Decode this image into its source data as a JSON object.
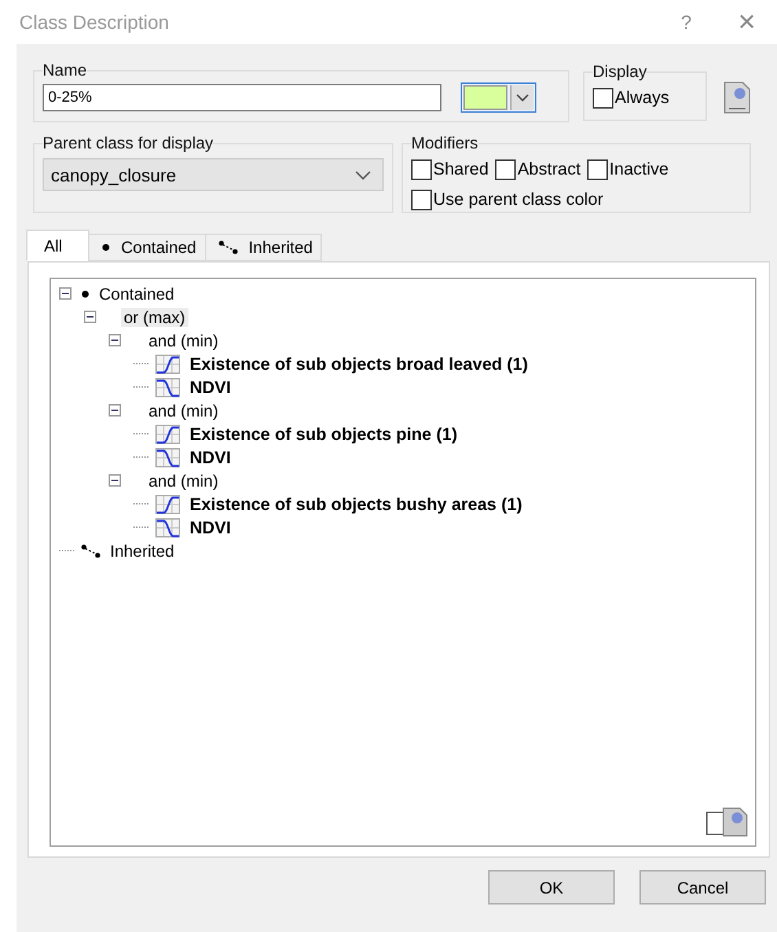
{
  "window": {
    "title": "Class Description",
    "help": "?",
    "close": "×"
  },
  "name_group": {
    "label": "Name",
    "value": "0-25%"
  },
  "display_group": {
    "label": "Display",
    "checkboxes": [
      {
        "label": "Always",
        "checked": false
      }
    ]
  },
  "parent_group": {
    "label": "Parent class for display",
    "value": "canopy_closure"
  },
  "modifiers_group": {
    "label": "Modifiers",
    "checkboxes": [
      {
        "label": "Shared",
        "checked": false
      },
      {
        "label": "Abstract",
        "checked": false
      },
      {
        "label": "Inactive",
        "checked": false
      },
      {
        "label": "Use parent class color",
        "checked": false
      }
    ]
  },
  "tabs": [
    {
      "label": "All",
      "kind": "plain",
      "selected": true
    },
    {
      "label": "Contained",
      "kind": "dot",
      "selected": false
    },
    {
      "label": "Inherited",
      "kind": "link",
      "selected": false
    }
  ],
  "tree": [
    {
      "label": "Contained",
      "kind": "dot",
      "expanded": true,
      "selected": false,
      "children": [
        {
          "label": "or (max)",
          "kind": "operator",
          "expanded": true,
          "selected": true,
          "children": [
            {
              "label": "and (min)",
              "kind": "operator",
              "expanded": true,
              "selected": false,
              "children": [
                {
                  "label": "Existence of sub objects broad leaved (1)",
                  "kind": "rising",
                  "selected": false
                },
                {
                  "label": "NDVI",
                  "kind": "falling",
                  "selected": false
                }
              ]
            },
            {
              "label": "and (min)",
              "kind": "operator",
              "expanded": true,
              "selected": false,
              "children": [
                {
                  "label": "Existence of sub objects pine (1)",
                  "kind": "rising",
                  "selected": false
                },
                {
                  "label": "NDVI",
                  "kind": "falling",
                  "selected": false
                }
              ]
            },
            {
              "label": "and (min)",
              "kind": "operator",
              "expanded": true,
              "selected": false,
              "children": [
                {
                  "label": "Existence of sub objects bushy areas (1)",
                  "kind": "rising",
                  "selected": false
                },
                {
                  "label": "NDVI",
                  "kind": "falling",
                  "selected": false
                }
              ]
            }
          ]
        }
      ]
    },
    {
      "label": "Inherited",
      "kind": "link",
      "selected": false
    }
  ],
  "buttons": [
    {
      "label": "OK"
    },
    {
      "label": "Cancel"
    }
  ]
}
